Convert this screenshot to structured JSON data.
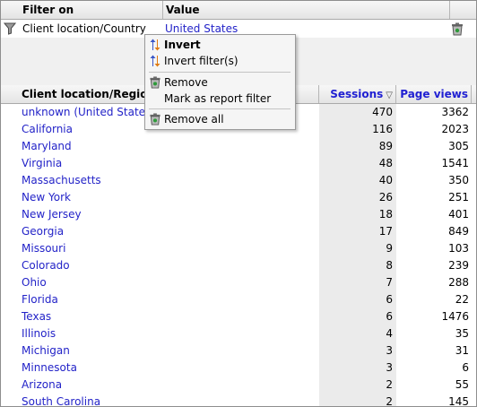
{
  "filter_panel": {
    "columns": [
      "Filter on",
      "Value"
    ],
    "row": {
      "field": "Client location/Country",
      "value": "United States"
    }
  },
  "table": {
    "columns": {
      "location": "Client location/Region",
      "sessions": "Sessions",
      "pageviews": "Page views"
    },
    "rows": [
      {
        "location": "unknown (United States)",
        "sessions": "470",
        "pageviews": "3362"
      },
      {
        "location": "California",
        "sessions": "116",
        "pageviews": "2023"
      },
      {
        "location": "Maryland",
        "sessions": "89",
        "pageviews": "305"
      },
      {
        "location": "Virginia",
        "sessions": "48",
        "pageviews": "1541"
      },
      {
        "location": "Massachusetts",
        "sessions": "40",
        "pageviews": "350"
      },
      {
        "location": "New York",
        "sessions": "26",
        "pageviews": "251"
      },
      {
        "location": "New Jersey",
        "sessions": "18",
        "pageviews": "401"
      },
      {
        "location": "Georgia",
        "sessions": "17",
        "pageviews": "849"
      },
      {
        "location": "Missouri",
        "sessions": "9",
        "pageviews": "103"
      },
      {
        "location": "Colorado",
        "sessions": "8",
        "pageviews": "239"
      },
      {
        "location": "Ohio",
        "sessions": "7",
        "pageviews": "288"
      },
      {
        "location": "Florida",
        "sessions": "6",
        "pageviews": "22"
      },
      {
        "location": "Texas",
        "sessions": "6",
        "pageviews": "1476"
      },
      {
        "location": "Illinois",
        "sessions": "4",
        "pageviews": "35"
      },
      {
        "location": "Michigan",
        "sessions": "3",
        "pageviews": "31"
      },
      {
        "location": "Minnesota",
        "sessions": "3",
        "pageviews": "6"
      },
      {
        "location": "Arizona",
        "sessions": "2",
        "pageviews": "55"
      },
      {
        "location": "South Carolina",
        "sessions": "2",
        "pageviews": "145"
      }
    ]
  },
  "context_menu": {
    "invert": "Invert",
    "invert_filters": "Invert filter(s)",
    "remove": "Remove",
    "mark_report_filter": "Mark as report filter",
    "remove_all": "Remove all"
  },
  "colors": {
    "link": "#2323c8",
    "header_link": "#1f1fd2",
    "sorted_column_bg": "#ebebeb"
  }
}
